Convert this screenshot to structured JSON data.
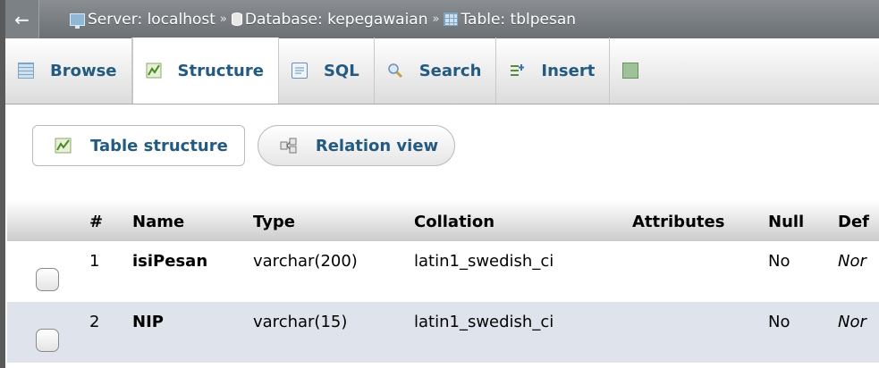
{
  "breadcrumb": {
    "back_icon": "left-arrow-icon",
    "server": "Server: localhost",
    "database": "Database: kepegawaian",
    "table": "Table: tblpesan",
    "separator": "»"
  },
  "tabs": [
    {
      "label": "Browse",
      "icon": "browse-icon"
    },
    {
      "label": "Structure",
      "icon": "structure-icon",
      "active": true
    },
    {
      "label": "SQL",
      "icon": "sql-icon"
    },
    {
      "label": "Search",
      "icon": "search-icon"
    },
    {
      "label": "Insert",
      "icon": "insert-icon"
    },
    {
      "label": "",
      "icon": "export-icon"
    }
  ],
  "subtabs": [
    {
      "label": "Table structure",
      "icon": "table-structure-icon"
    },
    {
      "label": "Relation view",
      "icon": "relation-view-icon"
    }
  ],
  "table": {
    "headers": [
      "#",
      "Name",
      "Type",
      "Collation",
      "Attributes",
      "Null",
      "Def"
    ],
    "rows": [
      {
        "num": "1",
        "name": "isiPesan",
        "type": "varchar(200)",
        "collation": "latin1_swedish_ci",
        "attributes": "",
        "null": "No",
        "default": "Nor"
      },
      {
        "num": "2",
        "name": "NIP",
        "type": "varchar(15)",
        "collation": "latin1_swedish_ci",
        "attributes": "",
        "null": "No",
        "default": "Nor"
      }
    ]
  },
  "colors": {
    "link": "#235a81",
    "topbar": "#7a7f84",
    "row_even": "#dfe4ec"
  }
}
